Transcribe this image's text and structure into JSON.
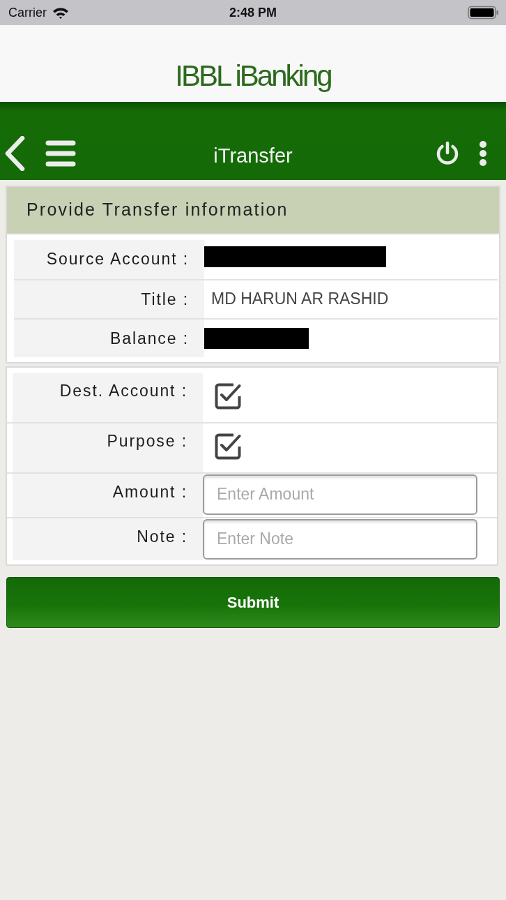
{
  "status_bar": {
    "carrier": "Carrier",
    "time": "2:48 PM"
  },
  "header": {
    "logo": "IBBL iBanking"
  },
  "navbar": {
    "title": "iTransfer"
  },
  "source_panel": {
    "title": "Provide Transfer information",
    "rows": [
      {
        "label": "Source Account :",
        "kind": "redacted"
      },
      {
        "label": "Title :",
        "kind": "text",
        "value": "MD HARUN AR RASHID"
      },
      {
        "label": "Balance :",
        "kind": "redacted"
      }
    ]
  },
  "transfer_form": {
    "rows": [
      {
        "label": "Dest. Account :",
        "kind": "checkbox",
        "checked": true
      },
      {
        "label": "Purpose :",
        "kind": "checkbox",
        "checked": true
      },
      {
        "label": "Amount :",
        "kind": "input",
        "placeholder": "Enter Amount"
      },
      {
        "label": "Note :",
        "kind": "input",
        "placeholder": "Enter Note"
      }
    ]
  },
  "submit_button": {
    "label": "Submit"
  }
}
